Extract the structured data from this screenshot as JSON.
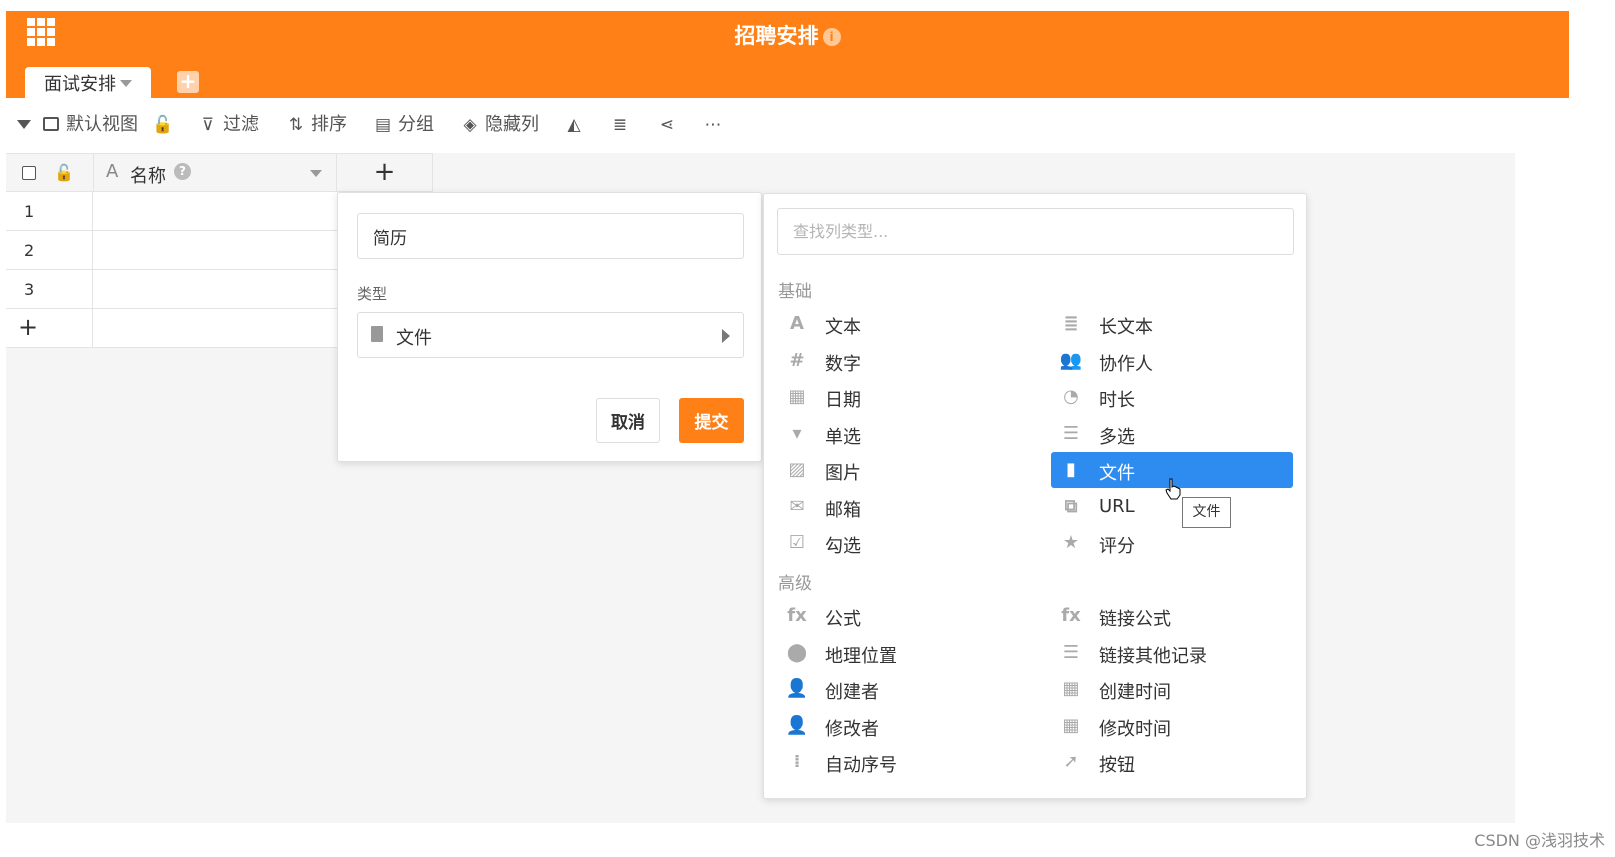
{
  "header": {
    "app_title": "招聘安排",
    "info_icon": "i",
    "tab_label": "面试安排",
    "add_tab_icon": "+",
    "accent_color": "#ff8016"
  },
  "toolbar": {
    "view_label": "默认视图",
    "filter_label": "过滤",
    "sort_label": "排序",
    "group_label": "分组",
    "hide_label": "隐藏列"
  },
  "grid": {
    "name_column": "名称",
    "help_icon": "?",
    "add_column_icon": "+",
    "rows": [
      "1",
      "2",
      "3"
    ],
    "add_row_icon": "+"
  },
  "column_editor": {
    "name_value": "简历",
    "type_label": "类型",
    "type_value": "文件",
    "cancel_label": "取消",
    "submit_label": "提交"
  },
  "type_chooser": {
    "search_placeholder": "查找列类型...",
    "basic_label": "基础",
    "advanced_label": "高级",
    "basic_options": [
      {
        "label": "文本",
        "icon": "text-icon",
        "glyph": "A"
      },
      {
        "label": "长文本",
        "icon": "long-text-icon",
        "glyph": "≣"
      },
      {
        "label": "数字",
        "icon": "number-icon",
        "glyph": "#"
      },
      {
        "label": "协作人",
        "icon": "collaborator-icon",
        "glyph": "👥"
      },
      {
        "label": "日期",
        "icon": "date-icon",
        "glyph": "▦"
      },
      {
        "label": "时长",
        "icon": "duration-icon",
        "glyph": "◔"
      },
      {
        "label": "单选",
        "icon": "single-select-icon",
        "glyph": "▾"
      },
      {
        "label": "多选",
        "icon": "multi-select-icon",
        "glyph": "☰"
      },
      {
        "label": "图片",
        "icon": "image-icon",
        "glyph": "▨"
      },
      {
        "label": "文件",
        "icon": "file-icon",
        "glyph": "▮"
      },
      {
        "label": "邮箱",
        "icon": "email-icon",
        "glyph": "✉"
      },
      {
        "label": "URL",
        "icon": "url-icon",
        "glyph": "⧉"
      },
      {
        "label": "勾选",
        "icon": "checkbox-icon",
        "glyph": "☑"
      },
      {
        "label": "评分",
        "icon": "rating-icon",
        "glyph": "★"
      }
    ],
    "advanced_options": [
      {
        "label": "公式",
        "icon": "formula-icon",
        "glyph": "fx"
      },
      {
        "label": "链接公式",
        "icon": "link-formula-icon",
        "glyph": "fx"
      },
      {
        "label": "地理位置",
        "icon": "location-icon",
        "glyph": "⬤"
      },
      {
        "label": "链接其他记录",
        "icon": "link-records-icon",
        "glyph": "☰"
      },
      {
        "label": "创建者",
        "icon": "creator-icon",
        "glyph": "👤"
      },
      {
        "label": "创建时间",
        "icon": "created-time-icon",
        "glyph": "▦"
      },
      {
        "label": "修改者",
        "icon": "modifier-icon",
        "glyph": "👤"
      },
      {
        "label": "修改时间",
        "icon": "modified-time-icon",
        "glyph": "▦"
      },
      {
        "label": "自动序号",
        "icon": "auto-number-icon",
        "glyph": "⁞"
      },
      {
        "label": "按钮",
        "icon": "button-icon",
        "glyph": "➚"
      }
    ],
    "selected": "文件",
    "selected_color": "#2e8cf0",
    "tooltip": "文件"
  },
  "watermark": "CSDN @浅羽技术"
}
